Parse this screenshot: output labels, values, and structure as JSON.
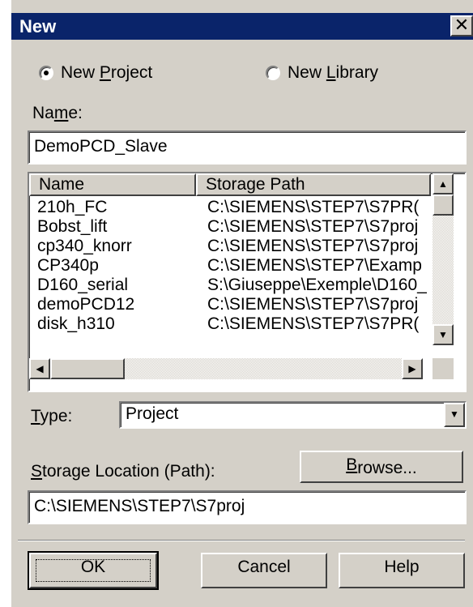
{
  "window": {
    "title": "New",
    "close_glyph": "✕"
  },
  "radios": [
    {
      "label_pre": "New ",
      "label_ul": "P",
      "label_post": "roject",
      "checked": true
    },
    {
      "label_pre": "New ",
      "label_ul": "L",
      "label_post": "ibrary",
      "checked": false
    }
  ],
  "name_field": {
    "label_pre": "Na",
    "label_ul": "m",
    "label_post": "e:",
    "value": "DemoPCD_Slave"
  },
  "project_list": {
    "columns": [
      "Name",
      "Storage Path"
    ],
    "rows": [
      {
        "name": "210h_FC",
        "path": "C:\\SIEMENS\\STEP7\\S7PR("
      },
      {
        "name": "Bobst_lift",
        "path": "C:\\SIEMENS\\STEP7\\S7proj"
      },
      {
        "name": "cp340_knorr",
        "path": "C:\\SIEMENS\\STEP7\\S7proj"
      },
      {
        "name": "CP340p",
        "path": "C:\\SIEMENS\\STEP7\\Examp"
      },
      {
        "name": "D160_serial",
        "path": "S:\\Giuseppe\\Exemple\\D160_"
      },
      {
        "name": "demoPCD12",
        "path": "C:\\SIEMENS\\STEP7\\S7proj"
      },
      {
        "name": "disk_h310",
        "path": "C:\\SIEMENS\\STEP7\\S7PR("
      }
    ]
  },
  "type_field": {
    "label_ul": "T",
    "label_post": "ype:",
    "value": "Project"
  },
  "storage": {
    "label_ul": "S",
    "label_post": "torage Location (Path):",
    "value": "C:\\SIEMENS\\STEP7\\S7proj"
  },
  "buttons": {
    "browse": {
      "ul": "B",
      "post": "rowse..."
    },
    "ok": "OK",
    "cancel": "Cancel",
    "help": "Help"
  }
}
